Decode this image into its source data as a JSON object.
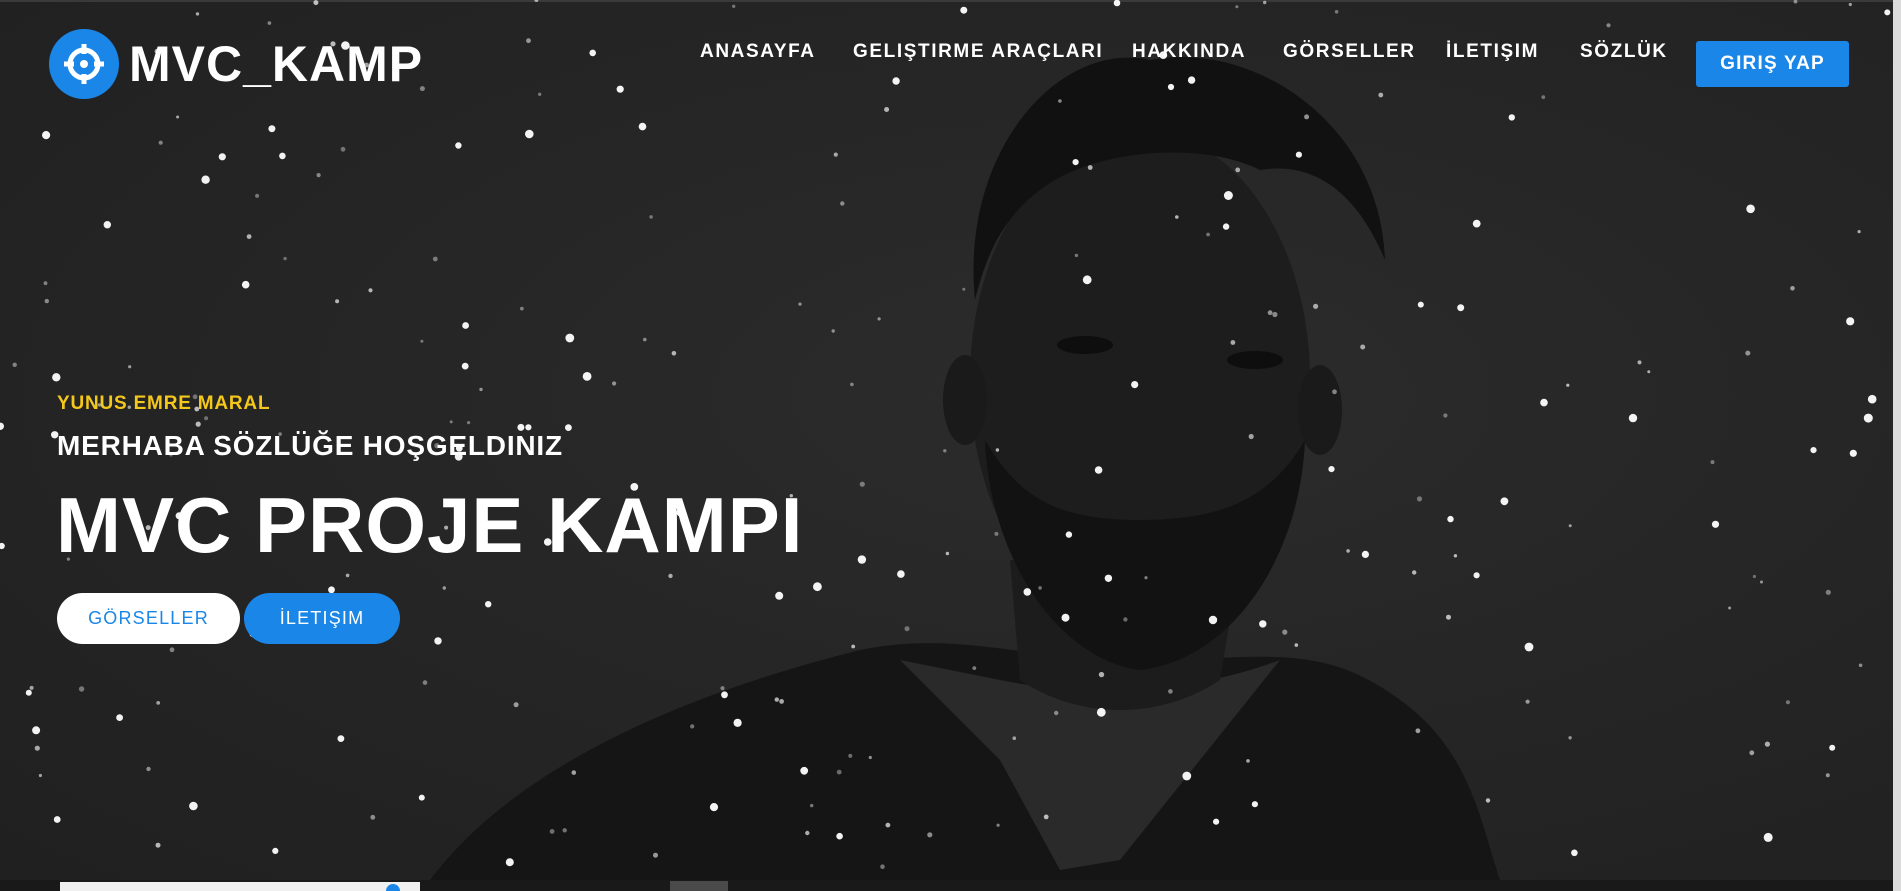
{
  "brand": {
    "logo_text": "MVC_KAMP",
    "icon": "crosshair-icon",
    "color": "#1a86e8"
  },
  "nav": {
    "items": [
      {
        "label": "ANASAYFA"
      },
      {
        "label": "GELIŞTIRME ARAÇLARI"
      },
      {
        "label": "HAKKINDA"
      },
      {
        "label": "GÖRSELLER"
      },
      {
        "label": "İLETIŞIM"
      },
      {
        "label": "SÖZLÜK"
      }
    ],
    "login_label": "GIRIŞ YAP"
  },
  "hero": {
    "eyebrow": "YUNUS EMRE MARAL",
    "subtitle": "MERHABA SÖZLÜĞE HOŞGELDINIZ",
    "headline": "MVC PROJE KAMPI",
    "buttons": {
      "images_label": "GÖRSELLER",
      "contact_label": "İLETIŞIM"
    },
    "accent_color": "#f4c81b"
  }
}
